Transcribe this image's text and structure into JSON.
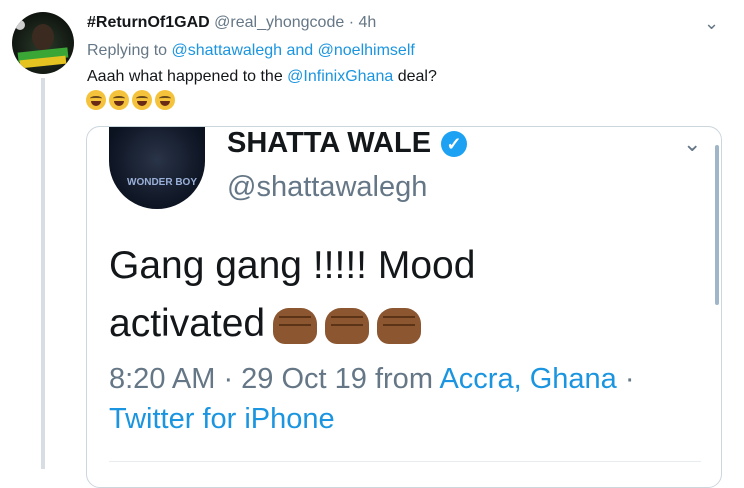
{
  "tweet": {
    "display_name": "#ReturnOf1GAD",
    "handle": "@real_yhongcode",
    "separator": "·",
    "time": "4h",
    "replying_prefix": "Replying to",
    "reply_user_1": "@shattawalegh",
    "reply_and": "and",
    "reply_user_2": "@noelhimself",
    "text_before": "Aaah what happened to the",
    "text_mention": "@InfinixGhana",
    "text_after": "deal?",
    "emoji_count": 4,
    "emoji_name": "tears-of-joy"
  },
  "quoted": {
    "display_name": "SHATTA WALE",
    "verified_glyph": "✓",
    "handle": "@shattawalegh",
    "avatar_label": "WONDER BOY",
    "line1": "Gang gang !!!!!  Mood",
    "line2": "activated",
    "fist_count": 3,
    "meta_time": "8:20 AM · 29 Oct 19 from",
    "meta_location": "Accra, Ghana",
    "meta_dot": "·",
    "meta_source": "Twitter for iPhone"
  },
  "icons": {
    "chevron": "chevron-down-icon",
    "verified": "verified-badge-icon"
  },
  "colors": {
    "link": "#1b95e0",
    "muted": "#657786",
    "verified": "#1da1f2"
  }
}
